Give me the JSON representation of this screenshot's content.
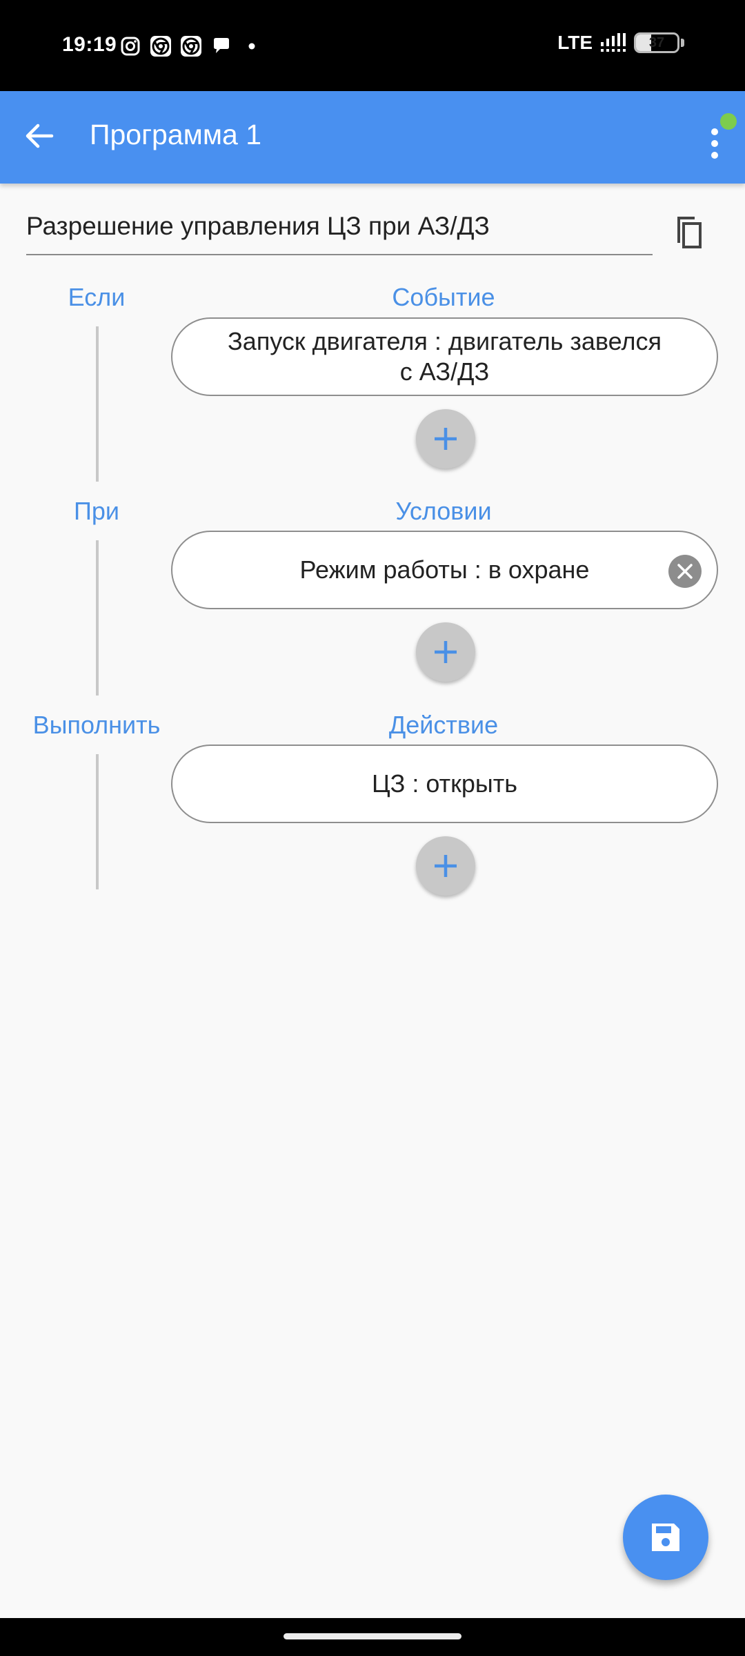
{
  "status_bar": {
    "time": "19:19",
    "left_icons": [
      "instagram-icon",
      "chrome-icon",
      "chrome-icon",
      "chat-icon",
      "dot-icon"
    ],
    "network": "LTE",
    "signal_icon": "signal-icon",
    "battery_level": "37",
    "battery_fraction": 0.37
  },
  "app_bar": {
    "title": "Программа 1",
    "back_icon": "arrow-left-icon",
    "menu_icon": "more-vert-icon",
    "notification_color": "#7dcc4e",
    "color": "#4990f0"
  },
  "program": {
    "name": "Разрешение управления ЦЗ при АЗ/ДЗ",
    "copy_icon": "copy-icon"
  },
  "sections": [
    {
      "label": "Если",
      "title": "Событие",
      "items": [
        {
          "line1": "Запуск двигателя : двигатель завелся",
          "line2": "с АЗ/ДЗ"
        }
      ]
    },
    {
      "label": "При",
      "title": "Условии",
      "items": [
        {
          "text": "Режим работы : в охране",
          "removable": true
        }
      ]
    },
    {
      "label": "Выполнить",
      "title": "Действие",
      "items": [
        {
          "text": "ЦЗ : открыть"
        }
      ]
    }
  ],
  "add_icon": "plus-icon",
  "fab": {
    "icon": "save-icon"
  }
}
